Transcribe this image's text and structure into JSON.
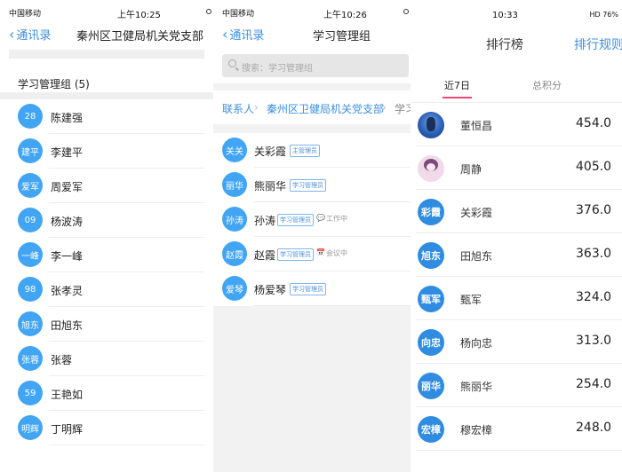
{
  "screen1": {
    "status": {
      "carrier": "中国移动",
      "time": "上午10:25"
    },
    "back_label": "通讯录",
    "title": "秦州区卫健局机关党支部",
    "group_header": "学习管理组 (5)",
    "members": [
      {
        "avatar": "28",
        "name": "陈建强"
      },
      {
        "avatar": "建平",
        "name": "李建平"
      },
      {
        "avatar": "爱军",
        "name": "周爱军"
      },
      {
        "avatar": "09",
        "name": "杨波涛"
      },
      {
        "avatar": "一峰",
        "name": "李一峰"
      },
      {
        "avatar": "98",
        "name": "张孝灵"
      },
      {
        "avatar": "旭东",
        "name": "田旭东"
      },
      {
        "avatar": "张蓉",
        "name": "张蓉"
      },
      {
        "avatar": "59",
        "name": "王艳如"
      },
      {
        "avatar": "明辉",
        "name": "丁明辉"
      }
    ]
  },
  "screen2": {
    "status": {
      "carrier": "中国移动",
      "time": "上午10:26"
    },
    "back_label": "通讯录",
    "title": "学习管理组",
    "search_placeholder": "搜索：学习管理组",
    "breadcrumb": [
      "联系人",
      "秦州区卫健局机关党支部",
      "学习"
    ],
    "members": [
      {
        "avatar": "关关",
        "name": "关彩霞",
        "tag": "主管理员",
        "status": ""
      },
      {
        "avatar": "丽华",
        "name": "熊丽华",
        "tag": "学习管理员",
        "status": ""
      },
      {
        "avatar": "孙涛",
        "name": "孙涛",
        "tag": "学习管理员",
        "status": "工作中"
      },
      {
        "avatar": "赵霞",
        "name": "赵霞",
        "tag": "学习管理员",
        "status": "会议中"
      },
      {
        "avatar": "爱琴",
        "name": "杨爱琴",
        "tag": "学习管理员",
        "status": ""
      }
    ]
  },
  "screen3": {
    "status": {
      "time": "10:33",
      "right": "HD 76%"
    },
    "title": "排行榜",
    "rule_label": "排行规则",
    "tabs": [
      "近7日",
      "总积分"
    ],
    "ranking": [
      {
        "avatar": "",
        "photo": "globe",
        "name": "董恒昌",
        "score": "454.0"
      },
      {
        "avatar": "",
        "photo": "girl",
        "name": "周静",
        "score": "405.0"
      },
      {
        "avatar": "彩霞",
        "photo": "",
        "name": "关彩霞",
        "score": "376.0"
      },
      {
        "avatar": "旭东",
        "photo": "",
        "name": "田旭东",
        "score": "363.0"
      },
      {
        "avatar": "甄军",
        "photo": "",
        "name": "甄军",
        "score": "324.0"
      },
      {
        "avatar": "向忠",
        "photo": "",
        "name": "杨向忠",
        "score": "313.0"
      },
      {
        "avatar": "丽华",
        "photo": "",
        "name": "熊丽华",
        "score": "254.0"
      },
      {
        "avatar": "宏樟",
        "photo": "",
        "name": "穆宏樟",
        "score": "248.0"
      }
    ],
    "accent_color": "#e8467a",
    "avatar_color": "#2f8ce0"
  }
}
